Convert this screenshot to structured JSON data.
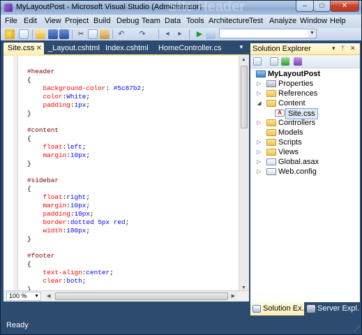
{
  "window": {
    "title": "MyLayoutPost - Microsoft Visual Studio (Administrator)",
    "background_watermark": "Site Header",
    "minimize": "–",
    "maximize": "□",
    "close": "✕"
  },
  "menu": [
    "File",
    "Edit",
    "View",
    "Project",
    "Build",
    "Debug",
    "Team",
    "Data",
    "Tools",
    "Architecture",
    "Test",
    "Analyze",
    "Window",
    "Help"
  ],
  "toolbar": {
    "icons": [
      "new-project-icon",
      "add-item-icon",
      "open-icon",
      "save-icon",
      "save-all-icon",
      "cut-icon",
      "copy-icon",
      "paste-icon",
      "undo-icon",
      "redo-icon",
      "navigate-back-icon",
      "navigate-forward-icon",
      "start-debugging-icon",
      "find-in-files-icon"
    ],
    "combo_value": ""
  },
  "document_tabs": [
    {
      "label": "Site.css",
      "active": true,
      "close": "✕"
    },
    {
      "label": "_Layout.cshtml",
      "active": false
    },
    {
      "label": "Index.cshtml",
      "active": false
    },
    {
      "label": "HomeController.cs",
      "active": false
    }
  ],
  "editor": {
    "code_lines": [
      [
        {
          "t": "#header",
          "c": "sel"
        }
      ],
      [
        {
          "t": "{",
          "c": "brace"
        }
      ],
      [
        {
          "t": "    background-color",
          "c": "prop"
        },
        {
          "t": ": ",
          "c": "punc"
        },
        {
          "t": "#5c87b2",
          "c": "val"
        },
        {
          "t": ";",
          "c": "punc"
        }
      ],
      [
        {
          "t": "    color",
          "c": "prop"
        },
        {
          "t": ":",
          "c": "punc"
        },
        {
          "t": "White",
          "c": "val"
        },
        {
          "t": ";",
          "c": "punc"
        }
      ],
      [
        {
          "t": "    padding",
          "c": "prop"
        },
        {
          "t": ":",
          "c": "punc"
        },
        {
          "t": "1px",
          "c": "val"
        },
        {
          "t": ";",
          "c": "punc"
        }
      ],
      [
        {
          "t": "}",
          "c": "brace"
        }
      ],
      [],
      [
        {
          "t": "#content",
          "c": "sel"
        }
      ],
      [
        {
          "t": "{",
          "c": "brace"
        }
      ],
      [
        {
          "t": "    float",
          "c": "prop"
        },
        {
          "t": ":",
          "c": "punc"
        },
        {
          "t": "left",
          "c": "val"
        },
        {
          "t": ";",
          "c": "punc"
        }
      ],
      [
        {
          "t": "    margin",
          "c": "prop"
        },
        {
          "t": ":",
          "c": "punc"
        },
        {
          "t": "10px",
          "c": "val"
        },
        {
          "t": ";",
          "c": "punc"
        }
      ],
      [
        {
          "t": "}",
          "c": "brace"
        }
      ],
      [],
      [
        {
          "t": "#sidebar",
          "c": "sel"
        }
      ],
      [
        {
          "t": "{",
          "c": "brace"
        }
      ],
      [
        {
          "t": "    float",
          "c": "prop"
        },
        {
          "t": ":",
          "c": "punc"
        },
        {
          "t": "right",
          "c": "val"
        },
        {
          "t": ";",
          "c": "punc"
        }
      ],
      [
        {
          "t": "    margin",
          "c": "prop"
        },
        {
          "t": ":",
          "c": "punc"
        },
        {
          "t": "10px",
          "c": "val"
        },
        {
          "t": ";",
          "c": "punc"
        }
      ],
      [
        {
          "t": "    padding",
          "c": "prop"
        },
        {
          "t": ":",
          "c": "punc"
        },
        {
          "t": "10px",
          "c": "val"
        },
        {
          "t": ";",
          "c": "punc"
        }
      ],
      [
        {
          "t": "    border",
          "c": "prop"
        },
        {
          "t": ":",
          "c": "punc"
        },
        {
          "t": "dotted 5px red",
          "c": "val"
        },
        {
          "t": ";",
          "c": "punc"
        }
      ],
      [
        {
          "t": "    width",
          "c": "prop"
        },
        {
          "t": ":",
          "c": "punc"
        },
        {
          "t": "180px",
          "c": "val"
        },
        {
          "t": ";",
          "c": "punc"
        }
      ],
      [
        {
          "t": "}",
          "c": "brace"
        }
      ],
      [],
      [
        {
          "t": "#footer",
          "c": "sel"
        }
      ],
      [
        {
          "t": "{",
          "c": "brace"
        }
      ],
      [
        {
          "t": "    text-align",
          "c": "prop"
        },
        {
          "t": ":",
          "c": "punc"
        },
        {
          "t": "center",
          "c": "val"
        },
        {
          "t": ";",
          "c": "punc"
        }
      ],
      [
        {
          "t": "    clear",
          "c": "prop"
        },
        {
          "t": ":",
          "c": "punc"
        },
        {
          "t": "both",
          "c": "val"
        },
        {
          "t": ";",
          "c": "punc"
        }
      ],
      [
        {
          "t": "}",
          "c": "brace"
        }
      ]
    ],
    "zoom": "100 %"
  },
  "solution_explorer": {
    "title": "Solution Explorer",
    "header_buttons": [
      "▾",
      "ᛘ",
      "✕"
    ],
    "tree": [
      {
        "label": "MyLayoutPost",
        "bold": true,
        "icon": "web-project-icon",
        "expander": ""
      },
      {
        "label": "Properties",
        "icon": "properties-icon",
        "expander": "▷"
      },
      {
        "label": "References",
        "icon": "references-icon",
        "expander": "▷"
      },
      {
        "label": "Content",
        "icon": "folder-open-icon",
        "expander": "◢"
      },
      {
        "label": "Site.css",
        "icon": "css-file-icon",
        "expander": "",
        "selected": true
      },
      {
        "label": "Controllers",
        "icon": "folder-icon",
        "expander": "▷"
      },
      {
        "label": "Models",
        "icon": "folder-icon",
        "expander": ""
      },
      {
        "label": "Scripts",
        "icon": "folder-icon",
        "expander": "▷"
      },
      {
        "label": "Views",
        "icon": "folder-icon",
        "expander": "▷"
      },
      {
        "label": "Global.asax",
        "icon": "global-asax-icon",
        "expander": "▷"
      },
      {
        "label": "Web.config",
        "icon": "config-file-icon",
        "expander": "▷"
      }
    ],
    "bottom_tabs": [
      {
        "label": "Solution Ex...",
        "active": true
      },
      {
        "label": "Server Expl...",
        "active": false
      }
    ]
  },
  "status": {
    "text": "Ready"
  },
  "colors": {
    "chrome": "#2d4a6f",
    "active_tab": "#fff0b8",
    "css_selector": "#800000",
    "css_property": "#ff0000",
    "css_value": "#0000ff"
  }
}
